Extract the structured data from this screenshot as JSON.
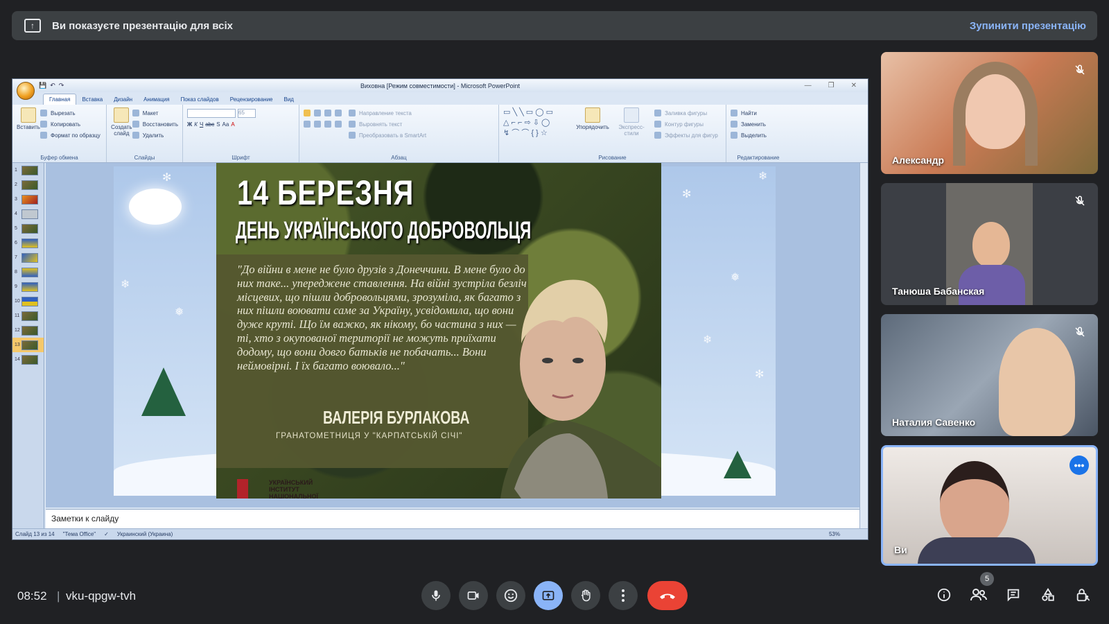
{
  "banner": {
    "text": "Ви показуєте презентацію для всіх",
    "stop": "Зупинити презентацію"
  },
  "pp": {
    "title": "Виховна [Режим совместимости] - Microsoft PowerPoint",
    "tabs": [
      "Главная",
      "Вставка",
      "Дизайн",
      "Анимация",
      "Показ слайдов",
      "Рецензирование",
      "Вид"
    ],
    "clipboard": {
      "paste": "Вставить",
      "cut": "Вырезать",
      "copy": "Копировать",
      "format": "Формат по образцу",
      "label": "Буфер обмена"
    },
    "slides_grp": {
      "new": "Создать слайд",
      "layout": "Макет",
      "reset": "Восстановить",
      "delete": "Удалить",
      "label": "Слайды"
    },
    "font_grp": {
      "size": "65",
      "label": "Шрифт"
    },
    "para_grp": {
      "dir": "Направление текста",
      "align": "Выровнять текст",
      "smartart": "Преобразовать в SmartArt",
      "label": "Абзац"
    },
    "draw_grp": {
      "arrange": "Упорядочить",
      "quick": "Экспресс-стили",
      "fill": "Заливка фигуры",
      "outline": "Контур фигуры",
      "effects": "Эффекты для фигур",
      "label": "Рисование"
    },
    "edit_grp": {
      "find": "Найти",
      "replace": "Заменить",
      "select": "Выделить",
      "label": "Редактирование"
    },
    "thumbs": [
      "1",
      "2",
      "3",
      "4",
      "5",
      "6",
      "7",
      "8",
      "9",
      "10",
      "11",
      "12",
      "13",
      "14"
    ],
    "notes": "Заметки к слайду",
    "status": {
      "slide": "Слайд 13 из 14",
      "theme": "\"Тема Office\"",
      "lang": "Украинский (Украина)",
      "zoom": "53%"
    }
  },
  "poster": {
    "date": "14 БЕРЕЗНЯ",
    "title": "ДЕНЬ УКРАЇНСЬКОГО ДОБРОВОЛЬЦЯ",
    "quote": "\"До війни в мене не було друзів з Донеччини. В мене було до них таке... упереджене ставлення. На війні зустріла безліч місцевих, що пішли добровольцями, зрозуміла, як багато з них пішли воювати саме за Україну, усвідомила, що вони дуже круті. Що їм важко, як нікому, бо частина з них — ті, хто з окупованої території не можуть приїхати додому, що вони довго батьків не побачать... Вони неймовірні. І їх багато воювало...\"",
    "name": "ВАЛЕРІЯ БУРЛАКОВА",
    "role": "ГРАНАТОМЕТНИЦЯ У \"КАРПАТСЬКІЙ СІЧІ\"",
    "inst": "УКРАЇНСЬКИЙ ІНСТИТУТ НАЦІОНАЛЬНОЇ"
  },
  "participants": [
    {
      "name": "Александр",
      "muted": true
    },
    {
      "name": "Танюша Бабанская",
      "muted": true
    },
    {
      "name": "Наталия Савенко",
      "muted": true
    },
    {
      "name": "Ви",
      "muted": false
    }
  ],
  "bottom": {
    "time": "08:52",
    "separator": "|",
    "code": "vku-qpgw-tvh",
    "people_count": "5"
  },
  "colors": {
    "bg": "#202124",
    "accent": "#8ab4f8",
    "end": "#ea4335",
    "tile_you": "#8ab4f8"
  }
}
